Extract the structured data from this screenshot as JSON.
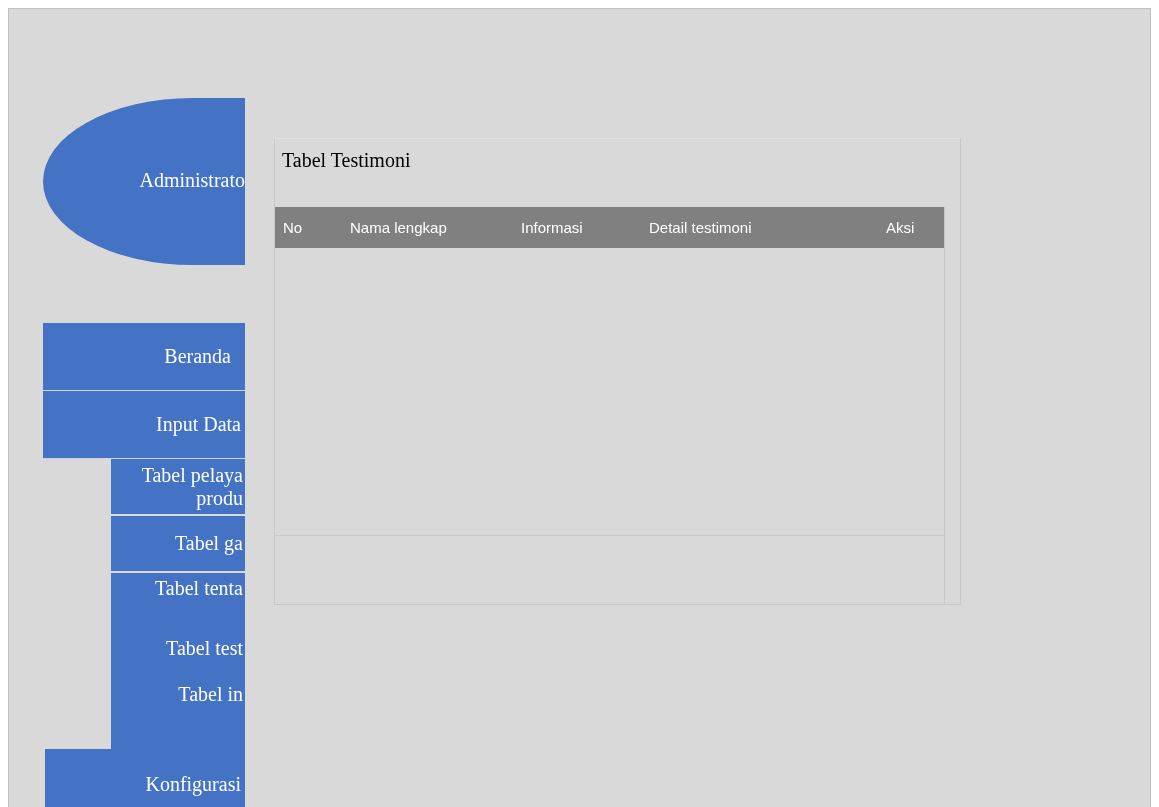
{
  "sidebar": {
    "header": "Administrato",
    "items": [
      {
        "label": "Beranda"
      },
      {
        "label": "Input Data",
        "children": [
          {
            "label": "Tabel pelaya produ",
            "kind": "boxed"
          },
          {
            "label": "Tabel ga",
            "kind": "boxed"
          },
          {
            "label": "Tabel tenta",
            "kind": "plain"
          },
          {
            "label": "Tabel test",
            "kind": "plain"
          },
          {
            "label": "Tabel in",
            "kind": "plain"
          }
        ]
      },
      {
        "label": "Konfigurasi"
      }
    ]
  },
  "panel": {
    "title": "Tabel Testimoni",
    "table": {
      "columns": [
        "No",
        "Nama lengkap",
        "Informasi",
        "Detail testimoni",
        "Aksi"
      ]
    }
  }
}
